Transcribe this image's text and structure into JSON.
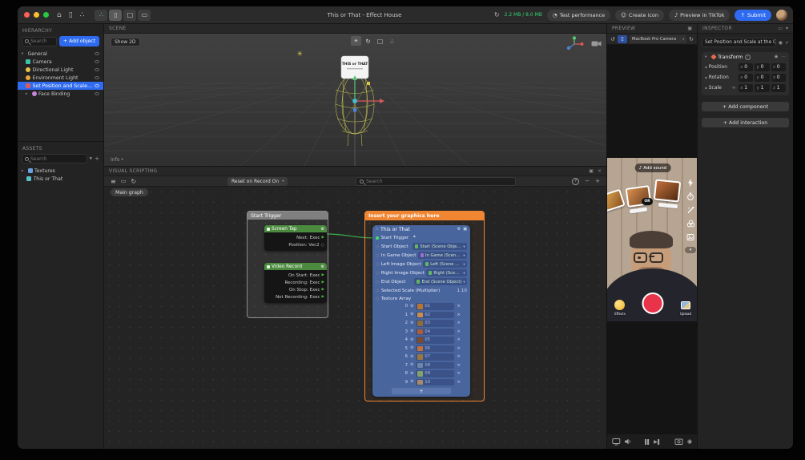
{
  "app": {
    "title": "This or That - Effect House"
  },
  "titlebar": {
    "memory": "2.2 MB / 8.0 MB",
    "test_performance": "Test performance",
    "create_icon": "Create icon",
    "preview_in_tiktok": "Preview in TikTok",
    "submit": "Submit"
  },
  "hierarchy": {
    "title": "HIERARCHY",
    "search_placeholder": "Search",
    "add_object_label": "+ Add object",
    "items": [
      {
        "label": "General"
      },
      {
        "label": "Camera"
      },
      {
        "label": "Directional Light"
      },
      {
        "label": "Environment Light"
      },
      {
        "label": "Set Position and Scale at the Obj..."
      },
      {
        "label": "Face Binding"
      }
    ]
  },
  "assets": {
    "title": "ASSETS",
    "search_placeholder": "Search",
    "items": [
      {
        "label": "Textures"
      },
      {
        "label": "This or That"
      }
    ]
  },
  "scene": {
    "title": "SCENE",
    "show_2d_label": "Show 2D",
    "info_label": "Info",
    "card_text": "THIS or THAT"
  },
  "visual_scripting": {
    "title": "VISUAL SCRIPTING",
    "reset_dropdown_value": "Reset on Record On",
    "search_placeholder": "Search",
    "tab_label": "Main graph",
    "start_group_title": "Start Trigger",
    "graphics_group_title": "Insert your graphics here",
    "screen_tap": {
      "title": "Screen Tap",
      "ports": [
        {
          "label": "Next: Exec"
        },
        {
          "label": "Position: Vec2"
        }
      ]
    },
    "video_record": {
      "title": "Video Record",
      "ports": [
        {
          "label": "On Start: Exec"
        },
        {
          "label": "Recording: Exec"
        },
        {
          "label": "On Stop: Exec"
        },
        {
          "label": "Not Recording: Exec"
        }
      ]
    },
    "this_or_that": {
      "title": "This or That",
      "exec_input_label": "Start Trigger",
      "fields": [
        {
          "label": "Start Object",
          "value": "Start (Scene Object)",
          "icon_color": "#63b663"
        },
        {
          "label": "In Game Object",
          "value": "In Game (Scene Object)",
          "icon_color": "#a06cd5"
        },
        {
          "label": "Left Image Object",
          "value": "Left (Scene Object)",
          "icon_color": "#63b663"
        },
        {
          "label": "Right Image Object",
          "value": "Right (Scene Object)",
          "icon_color": "#63b663"
        },
        {
          "label": "End Object",
          "value": "End (Scene Object)",
          "icon_color": "#63b663"
        }
      ],
      "scale_label": "Selected Scale (Multiplier)",
      "scale_value": "1.10",
      "array_label": "Texture Array",
      "textures": [
        {
          "index": "0",
          "label": "01",
          "thumb": "#b5742f"
        },
        {
          "index": "1",
          "label": "02",
          "thumb": "#c98f4a"
        },
        {
          "index": "2",
          "label": "03",
          "thumb": "#8f6b3a"
        },
        {
          "index": "3",
          "label": "04",
          "thumb": "#b05c33"
        },
        {
          "index": "4",
          "label": "05",
          "thumb": "#7b4b2a"
        },
        {
          "index": "5",
          "label": "06",
          "thumb": "#c2703d"
        },
        {
          "index": "6",
          "label": "07",
          "thumb": "#9a7741"
        },
        {
          "index": "7",
          "label": "08",
          "thumb": "#6b86a8"
        },
        {
          "index": "8",
          "label": "09",
          "thumb": "#87a06b"
        },
        {
          "index": "9",
          "label": "10",
          "thumb": "#a8896b"
        }
      ],
      "add_label": "+"
    }
  },
  "preview": {
    "title": "PREVIEW",
    "camera_value": "MacBook Pro Camera",
    "add_sound_label": "Add sound",
    "or_badge": "OR",
    "effects_label": "Effects",
    "upload_label": "Upload"
  },
  "inspector": {
    "title": "INSPECTOR",
    "object_name": "Set Position and Scale at the Objects L...",
    "transform_label": "Transform",
    "rows": [
      {
        "label": "Position",
        "x": "0",
        "y": "0",
        "z": "0"
      },
      {
        "label": "Rotation",
        "x": "0",
        "y": "0",
        "z": "0"
      },
      {
        "label": "Scale",
        "x": "1",
        "y": "1",
        "z": "1"
      }
    ],
    "axis": {
      "x": "x",
      "y": "y",
      "z": "z"
    },
    "add_component_label": "+ Add component",
    "add_interaction_label": "+ Add interaction"
  },
  "colors": {
    "accent_blue": "#2e6bf0",
    "memory_green": "#35d06d",
    "node_green": "#4c8b3f",
    "group_orange": "#f08532",
    "node_blue": "#49659e",
    "wire_green": "#3fb14b",
    "record_red": "#e8334a"
  },
  "icons": {
    "gear": "⚙",
    "exec": "▶",
    "port": "○",
    "chevron_down": "▾",
    "chevron_right": "▸",
    "plus": "+",
    "minus": "−",
    "close": "×",
    "help": "?",
    "popout": "▣",
    "refresh": "↻",
    "reset": "↺",
    "hamburger": "≡",
    "frame": "▭",
    "dots": "⋯",
    "info": "i",
    "check": "✓",
    "link": "∞",
    "sun": "☀",
    "home": "⌂",
    "device": "▯",
    "move": "⌖",
    "rotate": "↻",
    "scale_tool": "□",
    "axes": "∴",
    "music": "♪",
    "keyframe": "▪",
    "record": "◉",
    "flower": "*",
    "pin": "◎",
    "filter": "▼",
    "speed": "◔",
    "smiley": "☺",
    "upload_arrow": "↑",
    "graph": "∴"
  }
}
